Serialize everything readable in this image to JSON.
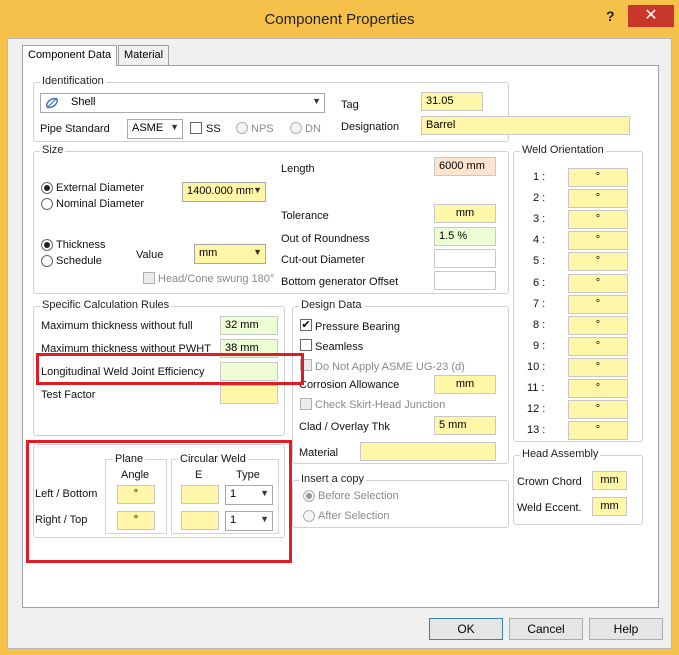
{
  "window": {
    "title": "Component Properties",
    "help": "?",
    "close": "✕"
  },
  "tabs": [
    "Component Data",
    "Material"
  ],
  "identification": {
    "group": "Identification",
    "type_value": "Shell",
    "pipe_standard_label": "Pipe Standard",
    "pipe_standard_value": "ASME",
    "ss_label": "SS",
    "nps_label": "NPS",
    "dn_label": "DN",
    "tag_label": "Tag",
    "tag_value": "31.05",
    "designation_label": "Designation",
    "designation_value": "Barrel"
  },
  "size": {
    "group": "Size",
    "external_diameter": "External Diameter",
    "nominal_diameter": "Nominal Diameter",
    "diameter_value": "1400.000 mm",
    "thickness": "Thickness",
    "schedule": "Schedule",
    "value_label": "Value",
    "value_select": "mm",
    "head_cone": "Head/Cone swung 180°",
    "length_label": "Length",
    "length_value": "6000 mm",
    "tolerance_label": "Tolerance",
    "tolerance_value": "mm",
    "out_of_roundness_label": "Out of Roundness",
    "out_of_roundness_value": "1.5 %",
    "cutout_label": "Cut-out Diameter",
    "cutout_value": "",
    "bottom_gen_label": "Bottom generator Offset",
    "bottom_gen_value": ""
  },
  "weld_orientation": {
    "group": "Weld Orientation",
    "rows": [
      {
        "label": "1 :",
        "value": "°"
      },
      {
        "label": "2 :",
        "value": "°"
      },
      {
        "label": "3 :",
        "value": "°"
      },
      {
        "label": "4 :",
        "value": "°"
      },
      {
        "label": "5 :",
        "value": "°"
      },
      {
        "label": "6 :",
        "value": "°"
      },
      {
        "label": "7 :",
        "value": "°"
      },
      {
        "label": "8 :",
        "value": "°"
      },
      {
        "label": "9 :",
        "value": "°"
      },
      {
        "label": "10 :",
        "value": "°"
      },
      {
        "label": "11 :",
        "value": "°"
      },
      {
        "label": "12 :",
        "value": "°"
      },
      {
        "label": "13 :",
        "value": "°"
      }
    ]
  },
  "calc_rules": {
    "group": "Specific Calculation Rules",
    "max_thk_full_label": "Maximum thickness without full",
    "max_thk_full_value": "32 mm",
    "max_thk_pwht_label": "Maximum thickness without PWHT",
    "max_thk_pwht_value": "38 mm",
    "long_weld_label": "Longitudinal Weld Joint Efficiency",
    "long_weld_value": "",
    "test_factor_label": "Test Factor",
    "test_factor_value": ""
  },
  "plane": {
    "plane_header": "Plane",
    "angle_header": "Angle",
    "circ_header": "Circular Weld",
    "e_header": "E",
    "type_header": "Type",
    "left_bottom": "Left / Bottom",
    "right_top": "Right / Top",
    "angle_lb": "°",
    "angle_rt": "°",
    "e_lb": "",
    "e_rt": "",
    "type_lb": "1",
    "type_rt": "1"
  },
  "design": {
    "group": "Design Data",
    "pressure_bearing": "Pressure Bearing",
    "seamless": "Seamless",
    "no_ug23": "Do Not Apply ASME UG-23 (d)",
    "corrosion_label": "Corrosion Allowance",
    "corrosion_value": "mm",
    "check_skirt": "Check Skirt-Head Junction",
    "clad_label": "Clad / Overlay Thk",
    "clad_value": "5 mm",
    "material_label": "Material",
    "material_value": ""
  },
  "insert_copy": {
    "group": "Insert a copy",
    "before": "Before Selection",
    "after": "After Selection"
  },
  "head_assembly": {
    "group": "Head Assembly",
    "crown_label": "Crown Chord",
    "crown_value": "mm",
    "weld_ecc_label": "Weld Eccent.",
    "weld_ecc_value": "mm"
  },
  "buttons": {
    "ok": "OK",
    "cancel": "Cancel",
    "help": "Help"
  }
}
